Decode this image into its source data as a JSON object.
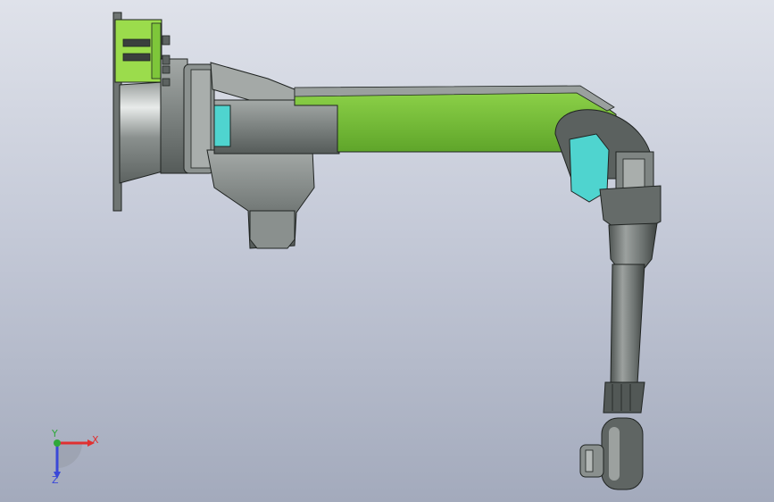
{
  "viewport": {
    "background_top": "#dfe2ea",
    "background_bottom": "#a3aabc"
  },
  "model": {
    "type": "robot-arm",
    "colors": {
      "highlight_green": "#7ec63a",
      "bracket_green": "#9bdc4c",
      "steel_gray": "#7f8583",
      "dark_gray": "#4c514f",
      "light_metal": "#c4c8c6",
      "cyan_motor": "#4fd4cf",
      "outline": "#1f2321"
    }
  },
  "triad": {
    "x_label": "X",
    "y_label": "Y",
    "z_label": "Z",
    "x_color": "#e03030",
    "y_color": "#2fa83a",
    "z_color": "#3a48d8"
  }
}
